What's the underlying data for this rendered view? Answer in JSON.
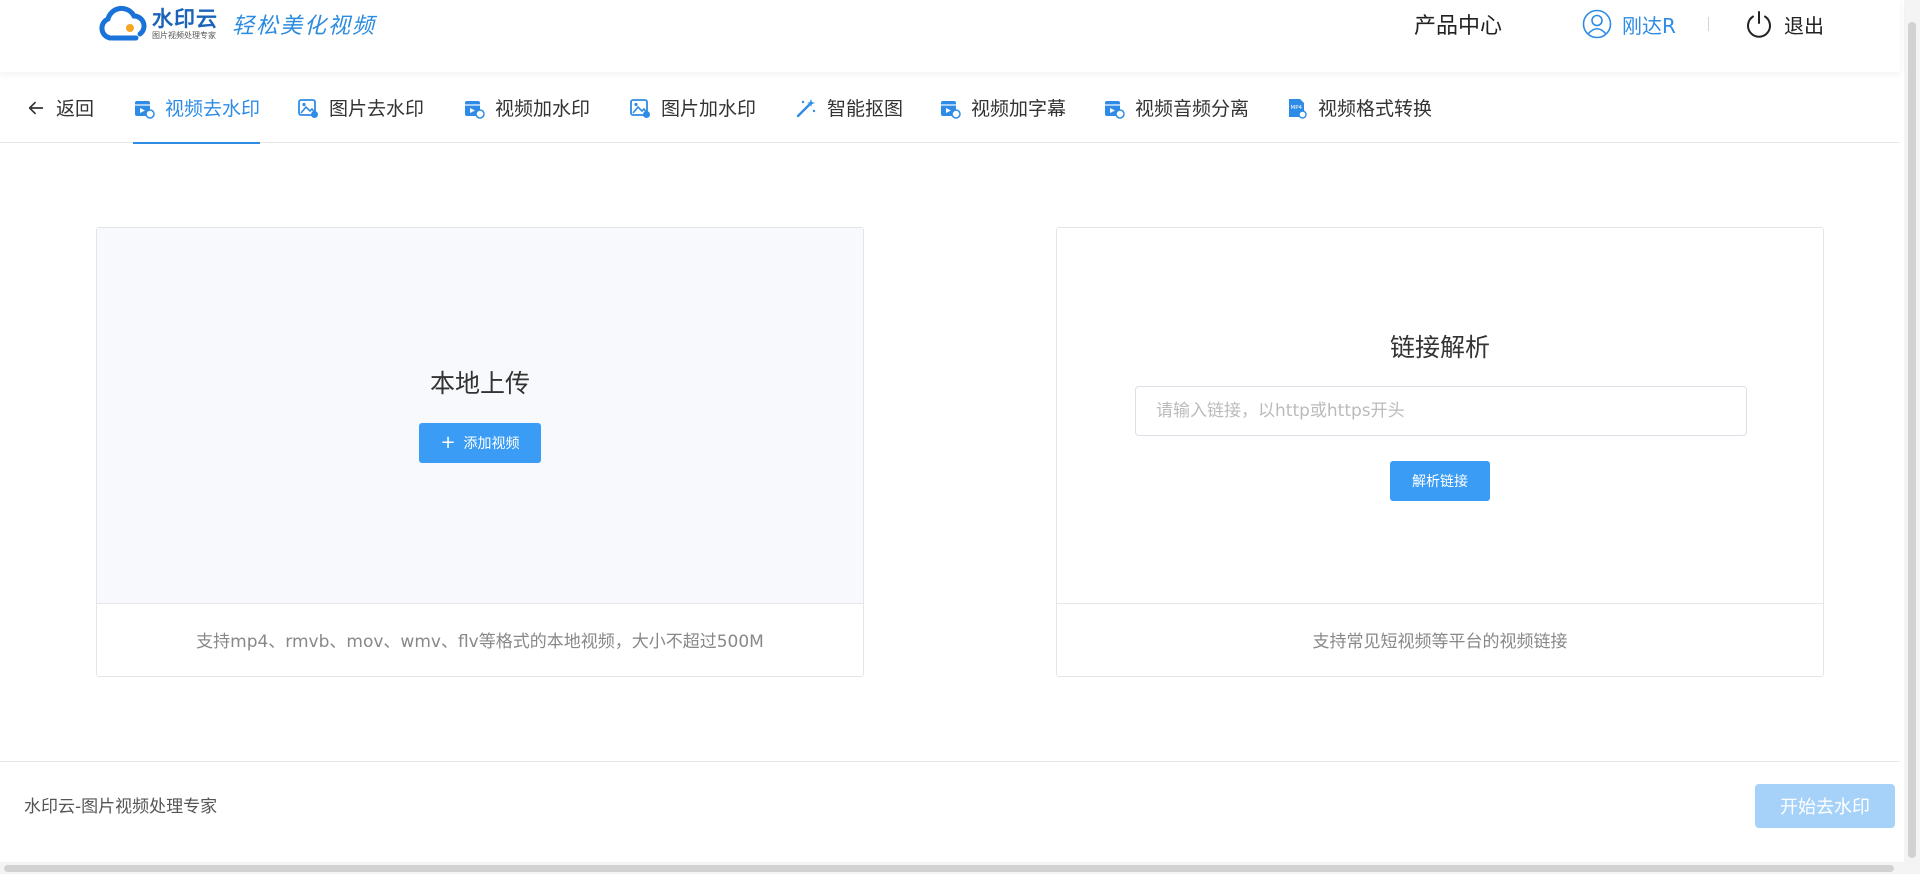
{
  "header": {
    "logo_name": "水印云",
    "logo_sub": "图片视频处理专家",
    "logo_slogan": "轻松美化视频",
    "product_center": "产品中心",
    "username": "刚达R",
    "logout": "退出"
  },
  "nav": {
    "back": "返回",
    "tabs": [
      {
        "label": "视频去水印",
        "icon": "video-icon",
        "active": true
      },
      {
        "label": "图片去水印",
        "icon": "image-icon"
      },
      {
        "label": "视频加水印",
        "icon": "video-icon"
      },
      {
        "label": "图片加水印",
        "icon": "image-icon"
      },
      {
        "label": "智能抠图",
        "icon": "magic-wand-icon"
      },
      {
        "label": "视频加字幕",
        "icon": "video-icon"
      },
      {
        "label": "视频音频分离",
        "icon": "video-icon"
      },
      {
        "label": "视频格式转换",
        "icon": "mp4-file-icon"
      }
    ]
  },
  "upload_card": {
    "title": "本地上传",
    "button": "添加视频",
    "hint": "支持mp4、rmvb、mov、wmv、flv等格式的本地视频，大小不超过500M"
  },
  "link_card": {
    "title": "链接解析",
    "input_value": "",
    "input_placeholder": "请输入链接，以http或https开头",
    "button": "解析链接",
    "hint": "支持常见短视频等平台的视频链接"
  },
  "footer": {
    "text": "水印云-图片视频处理专家",
    "start_button": "开始去水印"
  },
  "colors": {
    "accent": "#2e8ce6",
    "primary_button": "#3b9cf5",
    "disabled_button": "#a6d2fa",
    "upload_bg": "#f8f9fc"
  }
}
